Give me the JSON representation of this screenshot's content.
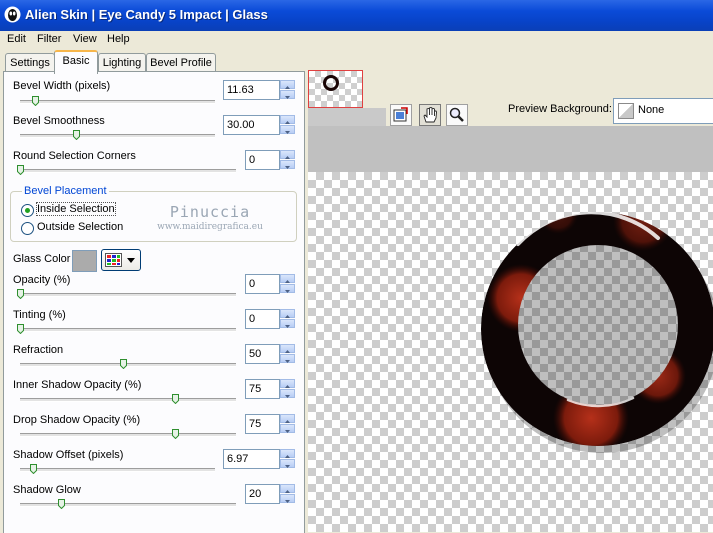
{
  "window": {
    "title": "Alien Skin | Eye Candy 5 Impact | Glass",
    "icon": "alien-skin-icon"
  },
  "menu": [
    "Edit",
    "Filter",
    "View",
    "Help"
  ],
  "tabs": [
    {
      "label": "Settings",
      "active": false
    },
    {
      "label": "Basic",
      "active": true
    },
    {
      "label": "Lighting",
      "active": false
    },
    {
      "label": "Bevel Profile",
      "active": false
    }
  ],
  "controls": {
    "bevel_width": {
      "label": "Bevel Width (pixels)",
      "value": "11.63",
      "slider_fraction": 0.08
    },
    "bevel_smoothness": {
      "label": "Bevel Smoothness",
      "value": "30.00",
      "slider_fraction": 0.3
    },
    "round_corners": {
      "label": "Round Selection Corners",
      "value": "0",
      "slider_fraction": 0.0
    },
    "opacity": {
      "label": "Opacity (%)",
      "value": "0",
      "slider_fraction": 0.0
    },
    "tinting": {
      "label": "Tinting (%)",
      "value": "0",
      "slider_fraction": 0.0
    },
    "refraction": {
      "label": "Refraction",
      "value": "50",
      "slider_fraction": 0.5
    },
    "inner_shadow_opacity": {
      "label": "Inner Shadow Opacity (%)",
      "value": "75",
      "slider_fraction": 0.75
    },
    "drop_shadow_opacity": {
      "label": "Drop Shadow Opacity (%)",
      "value": "75",
      "slider_fraction": 0.75
    },
    "shadow_offset": {
      "label": "Shadow Offset (pixels)",
      "value": "6.97",
      "slider_fraction": 0.07
    },
    "shadow_glow": {
      "label": "Shadow Glow",
      "value": "20",
      "slider_fraction": 0.2
    }
  },
  "bevel_placement": {
    "title": "Bevel Placement",
    "options": [
      "Inside Selection",
      "Outside Selection"
    ],
    "selected": 0
  },
  "glass_color": {
    "label": "Glass Color",
    "color": "#ababab"
  },
  "watermark": {
    "line1": "Pinuccia",
    "line2": "www.maidiregrafica.eu"
  },
  "preview": {
    "background_label": "Preview Background:",
    "background_value": "None",
    "tools": [
      "zoom-to-fit-icon",
      "hand-pan-icon",
      "magnifier-icon"
    ],
    "active_tool": 1
  },
  "colors": {
    "titlebar": "#0b4bd8",
    "ring_outer": "#0d0505",
    "ring_highlight": "#8a1e0e"
  }
}
